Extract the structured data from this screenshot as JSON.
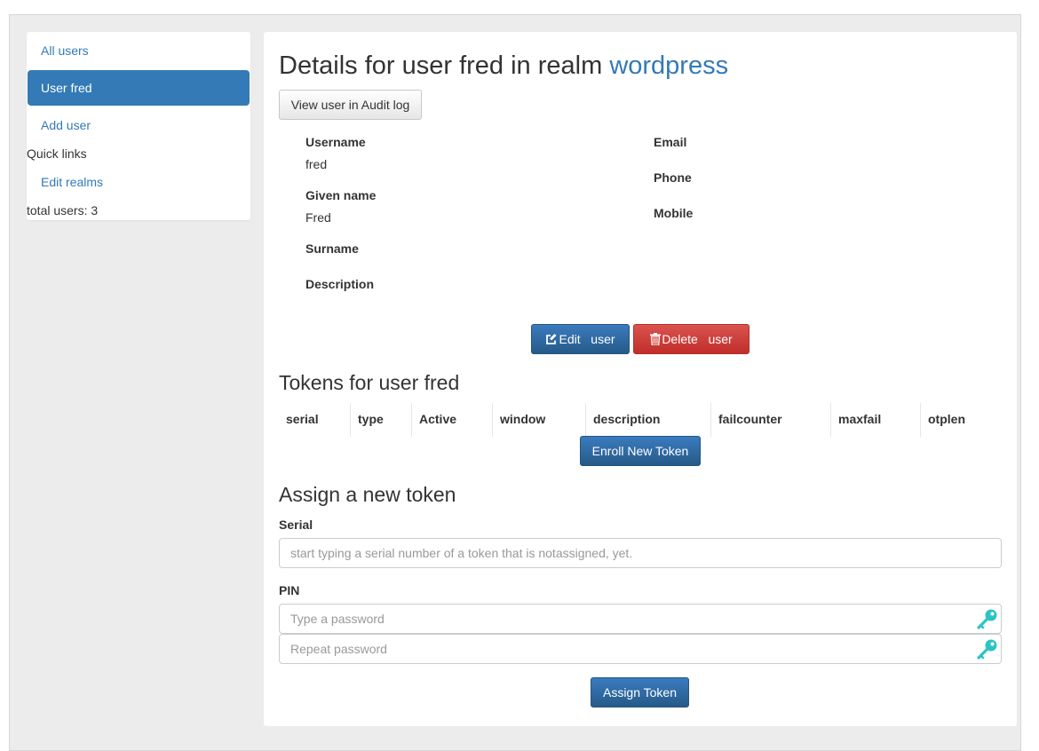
{
  "sidebar": {
    "items": [
      {
        "label": "All users",
        "active": false
      },
      {
        "label": "User fred",
        "active": true
      },
      {
        "label": "Add user",
        "active": false
      }
    ],
    "quick_links_label": "Quick links",
    "edit_realms_label": "Edit realms",
    "total_users_text": "total users: 3"
  },
  "details": {
    "title_prefix": "Details for user fred in realm",
    "realm_name": "wordpress",
    "audit_button_label": "View user in Audit log",
    "fields": {
      "username_label": "Username",
      "username_value": "fred",
      "given_name_label": "Given name",
      "given_name_value": "Fred",
      "surname_label": "Surname",
      "description_label": "Description",
      "email_label": "Email",
      "phone_label": "Phone",
      "mobile_label": "Mobile"
    },
    "edit_button_label": "Edit   user",
    "delete_button_label": "Delete   user"
  },
  "tokens": {
    "title": "Tokens for user fred",
    "columns": [
      "serial",
      "type",
      "Active",
      "window",
      "description",
      "failcounter",
      "maxfail",
      "otplen"
    ],
    "enroll_button_label": "Enroll New Token"
  },
  "assign": {
    "title": "Assign a new token",
    "serial_label": "Serial",
    "serial_placeholder": "start typing a serial number of a token that is notassigned, yet.",
    "pin_label": "PIN",
    "pin_placeholder": "Type a password",
    "pin_repeat_placeholder": "Repeat password",
    "assign_button_label": "Assign Token"
  },
  "colors": {
    "link": "#337ab7",
    "primary": "#2e6da4",
    "danger": "#d9534f",
    "key_icon": "#2bc4c4",
    "background": "#ececec"
  },
  "icons": {
    "edit": "edit-icon",
    "delete": "trash-icon",
    "password_generate": "key-icon"
  }
}
